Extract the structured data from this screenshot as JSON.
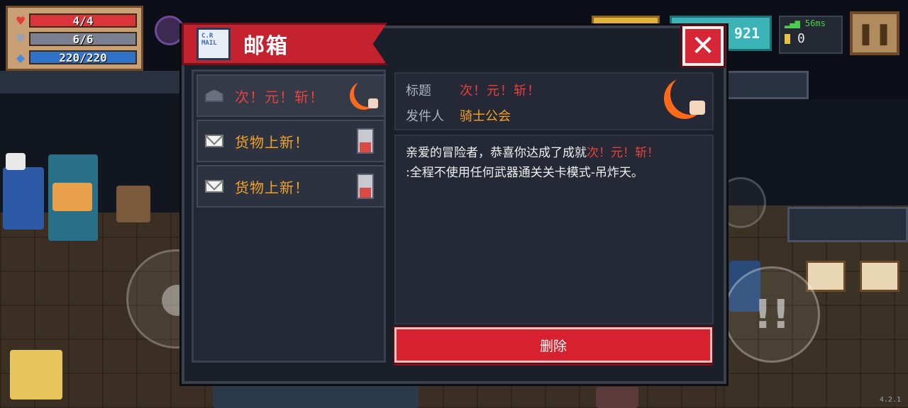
{
  "hud": {
    "health": "4/4",
    "armor": "6/6",
    "energy": "220/220",
    "gems": "921",
    "ping": "56ms",
    "coins": "0",
    "version": "4.2.1"
  },
  "mailbox": {
    "title": "邮箱",
    "icon_text": "C.R\nMAIL",
    "mails": [
      {
        "title": "次！元！斩！",
        "icon": "crescent-moon-icon",
        "read": true
      },
      {
        "title": "货物上新！",
        "icon": "shop-box-icon",
        "read": false
      },
      {
        "title": "货物上新！",
        "icon": "shop-box-icon",
        "read": false
      }
    ],
    "detail": {
      "subject_label": "标题",
      "subject": "次！元！斩！",
      "sender_label": "发件人",
      "sender": "骑士公会",
      "body_prefix": "亲爱的冒险者，恭喜你达成了成就",
      "body_highlight": "次！元！斩！",
      "body_suffix": ":全程不使用任何武器通关关卡模式-吊炸天。"
    },
    "delete_label": "删除"
  },
  "colors": {
    "accent_red": "#d7212f",
    "highlight_red": "#e8413f",
    "highlight_orange": "#f2a22b"
  }
}
